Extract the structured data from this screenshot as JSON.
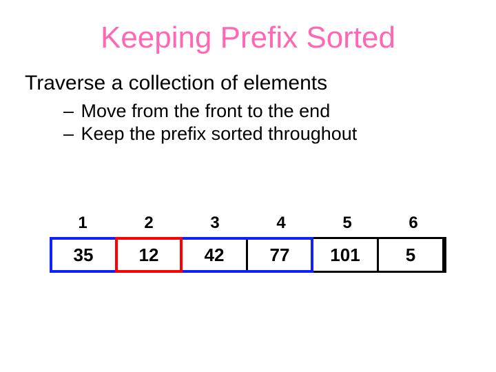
{
  "title": "Keeping Prefix Sorted",
  "intro": "Traverse a collection of elements",
  "bullets": [
    "Move from the front to the end",
    "Keep the prefix sorted throughout"
  ],
  "indices": [
    "1",
    "2",
    "3",
    "4",
    "5",
    "6"
  ],
  "cells": [
    "35",
    "12",
    "42",
    "77",
    "101",
    "5"
  ],
  "highlights": {
    "blue": {
      "start": 0,
      "end": 4
    },
    "red": {
      "start": 1,
      "end": 2
    }
  }
}
